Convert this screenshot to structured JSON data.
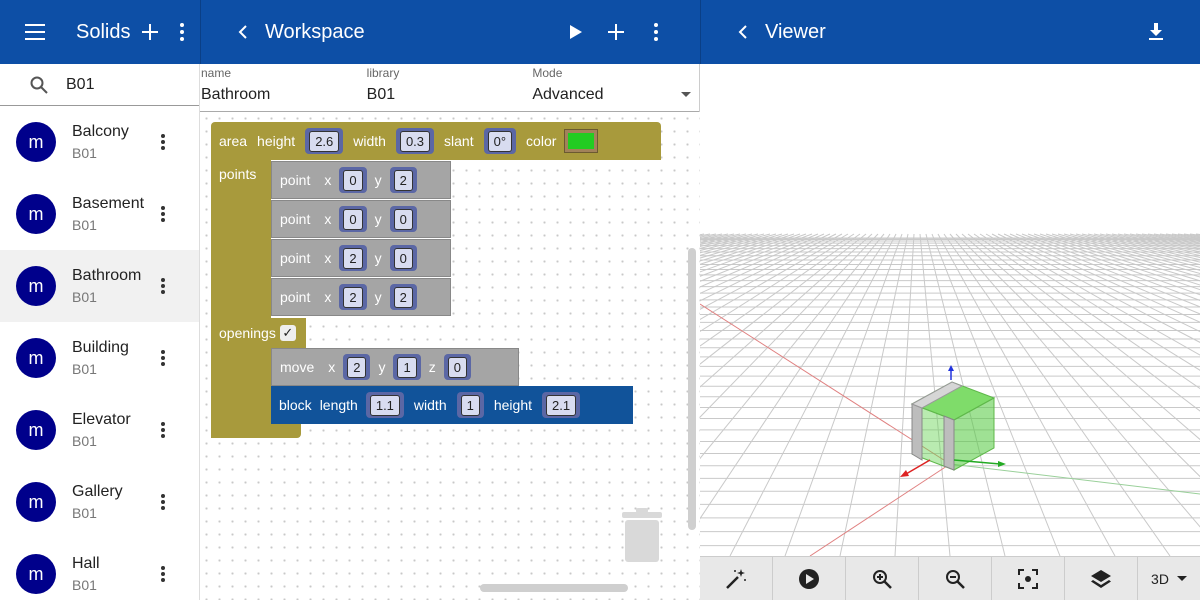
{
  "solids": {
    "title": "Solids",
    "search_value": "B01",
    "items": [
      {
        "avatar": "m",
        "name": "Balcony",
        "library": "B01"
      },
      {
        "avatar": "m",
        "name": "Basement",
        "library": "B01"
      },
      {
        "avatar": "m",
        "name": "Bathroom",
        "library": "B01"
      },
      {
        "avatar": "m",
        "name": "Building",
        "library": "B01"
      },
      {
        "avatar": "m",
        "name": "Elevator",
        "library": "B01"
      },
      {
        "avatar": "m",
        "name": "Gallery",
        "library": "B01"
      },
      {
        "avatar": "m",
        "name": "Hall",
        "library": "B01"
      }
    ]
  },
  "workspace": {
    "title": "Workspace",
    "form": {
      "name_label": "name",
      "name_value": "Bathroom",
      "library_label": "library",
      "library_value": "B01",
      "mode_label": "Mode",
      "mode_value": "Advanced"
    },
    "blocks": {
      "area": {
        "kw": "area",
        "height_label": "height",
        "height": "2.6",
        "width_label": "width",
        "width": "0.3",
        "slant_label": "slant",
        "slant": "0°",
        "color_label": "color",
        "color": "#22cc22"
      },
      "points_label": "points",
      "points": [
        {
          "kw": "point",
          "x_label": "x",
          "x": "0",
          "y_label": "y",
          "y": "2"
        },
        {
          "kw": "point",
          "x_label": "x",
          "x": "0",
          "y_label": "y",
          "y": "0"
        },
        {
          "kw": "point",
          "x_label": "x",
          "x": "2",
          "y_label": "y",
          "y": "0"
        },
        {
          "kw": "point",
          "x_label": "x",
          "x": "2",
          "y_label": "y",
          "y": "2"
        }
      ],
      "openings_label": "openings",
      "openings_checked": "✓",
      "move": {
        "kw": "move",
        "x_label": "x",
        "x": "2",
        "y_label": "y",
        "y": "1",
        "z_label": "z",
        "z": "0"
      },
      "block": {
        "kw": "block",
        "length_label": "length",
        "length": "1.1",
        "width_label": "width",
        "width": "1",
        "height_label": "height",
        "height": "2.1"
      }
    }
  },
  "viewer": {
    "title": "Viewer",
    "dimension": "3D"
  },
  "colors": {
    "header": "#0d4fa6",
    "avatar": "#00008b",
    "area_block": "#a89a3c",
    "point_block": "#a5a5a5",
    "block_block": "#11539a"
  }
}
